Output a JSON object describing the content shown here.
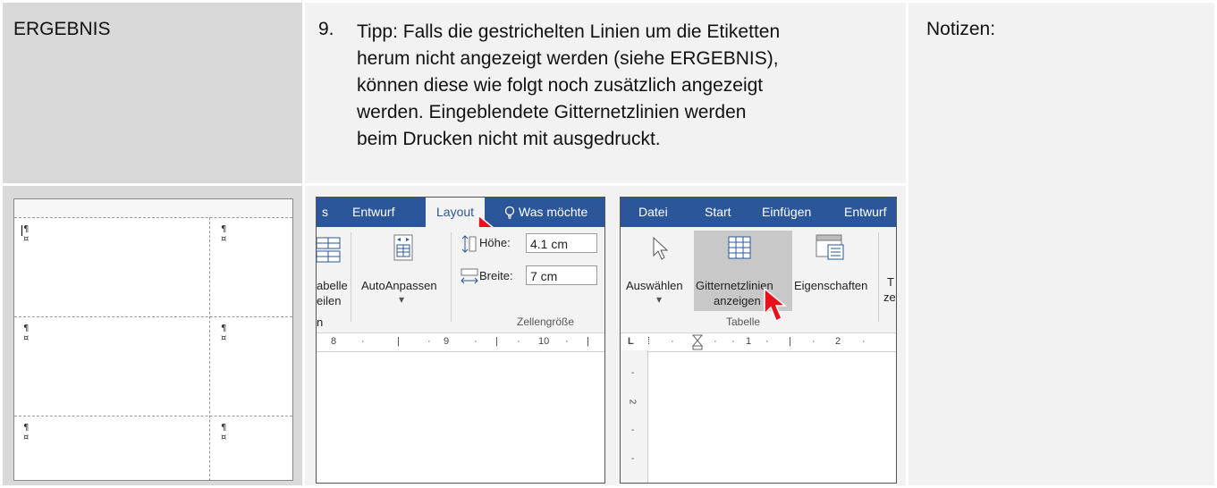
{
  "result_label": "ERGEBNIS",
  "tip": {
    "number": "9.",
    "lines": [
      "Tipp: Falls die gestrichelten Linien um die Etiketten",
      "herum nicht angezeigt werden (siehe ERGEBNIS),",
      "können diese wie folgt noch zusätzlich angezeigt",
      "werden. Eingeblendete Gitternetzlinien werden",
      "beim Drucken nicht mit ausgedruckt."
    ]
  },
  "notes_label": "Notizen:",
  "label_sheet": {
    "pilcrow": "¶",
    "cell_mark": "¤"
  },
  "layout_ribbon": {
    "tabs": [
      "s",
      "Entwurf",
      "Layout",
      "Was möchte"
    ],
    "active_tab": "Layout",
    "tabelle_partial": [
      "abelle",
      "eilen"
    ],
    "autofit_label": "AutoAnpassen",
    "height_label": "Höhe:",
    "height_value": "4.1 cm",
    "width_label": "Breite:",
    "width_value": "7 cm",
    "group_partial": "n",
    "group_label": "Zellengröße",
    "ruler": [
      "8",
      "9",
      "10"
    ]
  },
  "datei_ribbon": {
    "tabs": [
      "Datei",
      "Start",
      "Einfügen",
      "Entwurf"
    ],
    "select_label": "Auswählen",
    "gridlines_line1": "Gitternetzlinien",
    "gridlines_line2": "anzeigen",
    "properties_label": "Eigenschaften",
    "partial_t": "T",
    "partial_ze": "ze",
    "group_label": "Tabelle",
    "ruler": [
      "L",
      "1",
      "2"
    ],
    "vruler": [
      "-",
      "2",
      "-",
      "-"
    ]
  },
  "colors": {
    "accent": "#2b579a",
    "pointer": "#e8111b"
  }
}
